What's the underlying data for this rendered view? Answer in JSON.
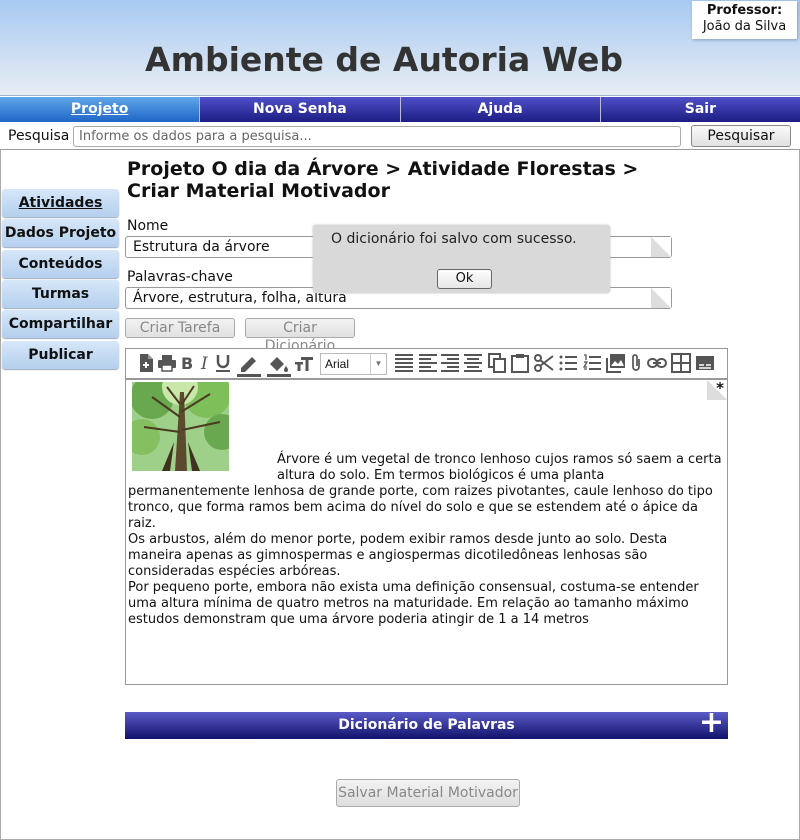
{
  "header": {
    "title": "Ambiente de Autoria Web",
    "professor_label": "Professor:",
    "professor_name": "João da Silva"
  },
  "nav": {
    "items": [
      {
        "label": "Projeto",
        "active": true
      },
      {
        "label": "Nova Senha"
      },
      {
        "label": "Ajuda"
      },
      {
        "label": "Sair"
      }
    ]
  },
  "search": {
    "label": "Pesquisa",
    "placeholder": "Informe os dados para a pesquisa...",
    "button": "Pesquisar"
  },
  "sidebar": {
    "items": [
      {
        "label": "Atividades",
        "active": true
      },
      {
        "label": "Dados Projeto"
      },
      {
        "label": "Conteúdos"
      },
      {
        "label": "Turmas"
      },
      {
        "label": "Compartilhar"
      },
      {
        "label": "Publicar"
      }
    ]
  },
  "breadcrumb": "Projeto O dia da Árvore > Atividade Florestas > Criar Material Motivador",
  "form": {
    "name_label": "Nome",
    "name_value": "Estrutura da árvore",
    "keywords_label": "Palavras-chave",
    "keywords_value": "Árvore, estrutura, folha, altura",
    "required_marker": "*",
    "create_task_button": "Criar Tarefa",
    "create_dictionary_button": "Criar Dicionário"
  },
  "editor": {
    "font": "Arial",
    "toolbar_icons": [
      "new-document-icon",
      "print-icon",
      "bold-icon",
      "italic-icon",
      "underline-icon",
      "pencil-icon",
      "fill-icon",
      "text-size-icon",
      "align-justify-icon",
      "align-left-icon",
      "align-right-icon",
      "align-center-icon",
      "copy-icon",
      "paste-icon",
      "cut-icon",
      "bullet-list-icon",
      "numbered-list-icon",
      "image-icon",
      "attachment-icon",
      "link-icon",
      "table-icon",
      "caption-icon"
    ],
    "paragraphs": [
      "Árvore é um vegetal de tronco lenhoso cujos ramos só saem a certa altura do solo. Em termos biológicos é uma planta permanentemente lenhosa de grande porte, com raizes pivotantes, caule lenhoso do tipo tronco, que forma ramos bem acima do nível do solo e que se estendem até o ápice da raiz.",
      "Os arbustos, além do menor porte, podem exibir ramos desde junto ao solo. Desta maneira apenas as gimnospermas e angiospermas dicotiledôneas lenhosas são consideradas espécies arbóreas.",
      "Por pequeno porte, embora não exista uma definição consensual, costuma-se entender uma altura mínima de quatro metros na maturidade. Em relação ao tamanho máximo estudos demonstram que uma árvore poderia atingir de 1 a 14 metros"
    ]
  },
  "dictionary": {
    "title": "Dicionário de Palavras",
    "expand": "+"
  },
  "save_button": "Salvar Material Motivador",
  "dialog": {
    "message": "O dicionário foi salvo com sucesso.",
    "ok": "Ok"
  }
}
